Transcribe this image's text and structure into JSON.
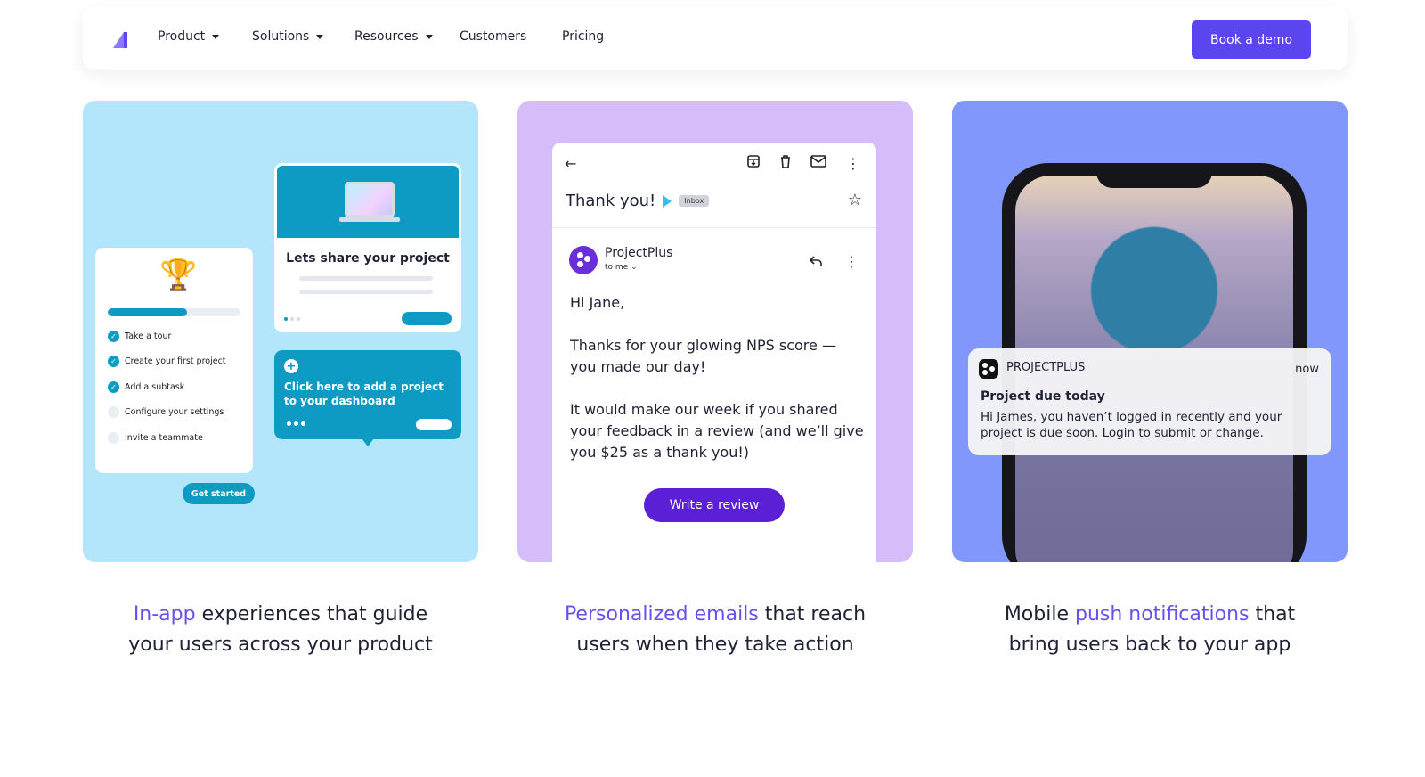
{
  "nav": {
    "items": [
      {
        "label": "Product",
        "dropdown": true
      },
      {
        "label": "Solutions",
        "dropdown": true
      },
      {
        "label": "Resources",
        "dropdown": true
      },
      {
        "label": "Customers",
        "dropdown": false
      },
      {
        "label": "Pricing",
        "dropdown": false
      }
    ],
    "cta_label": "Book a demo"
  },
  "colors": {
    "brand": "#5b45ee",
    "card1_bg": "#b3e5fb",
    "card2_bg": "#d6bdfa",
    "card3_bg": "#8197fb",
    "teal": "#0d9bc3"
  },
  "inapp": {
    "progress_pct": 60,
    "checklist": [
      {
        "label": "Take a tour",
        "done": true
      },
      {
        "label": "Create your first project",
        "done": true
      },
      {
        "label": "Add a subtask",
        "done": true
      },
      {
        "label": "Configure your settings",
        "done": false
      },
      {
        "label": "Invite a teammate",
        "done": false
      }
    ],
    "get_started": "Get started",
    "share_title": "Lets share your project",
    "tooltip_text": "Click here to add a project to your dashboard"
  },
  "email": {
    "subject": "Thank you!",
    "tag": "Inbox",
    "sender": "ProjectPlus",
    "to": "to me",
    "greeting": "Hi Jane,",
    "para1": "Thanks for your glowing NPS score —you made our day!",
    "para2": "It would make our week if you shared your feedback in a review (and we’ll give you $25 as a thank you!)",
    "button": "Write a review"
  },
  "push": {
    "app": "PROJECTPLUS",
    "time": "now",
    "title": "Project due today",
    "body": "Hi James, you haven’t logged in recently and your project is due soon. Login to submit or change."
  },
  "captions": [
    {
      "accent": "In-app",
      "line1_rest": " experiences that guide",
      "line2": "your users across your product"
    },
    {
      "accent": "Personalized emails",
      "line1_rest": " that reach",
      "line2": "users when they take action"
    },
    {
      "lead": "Mobile ",
      "accent": "push notifications",
      "line1_rest": " that",
      "line2": "bring users back to your app"
    }
  ]
}
